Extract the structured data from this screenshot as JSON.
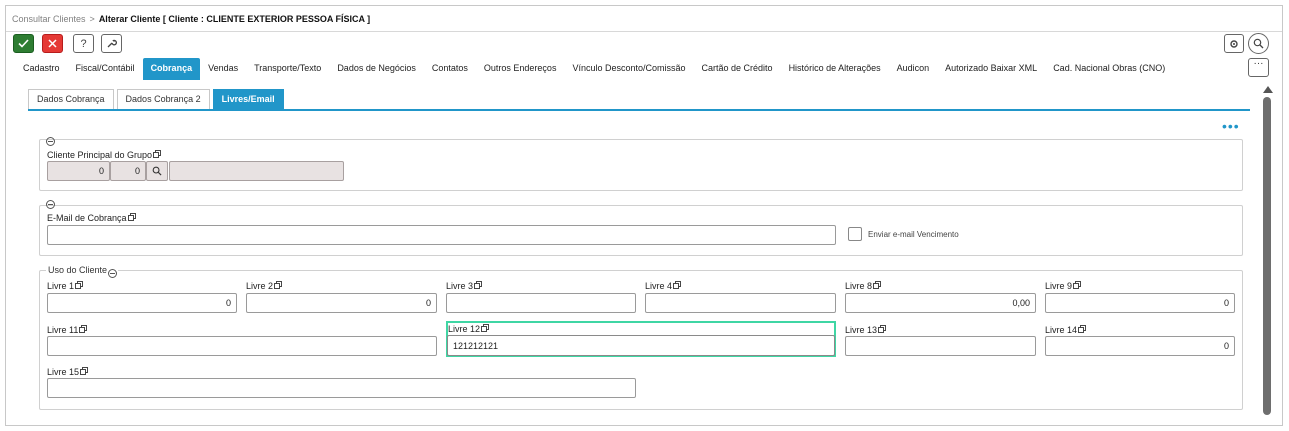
{
  "breadcrumb": {
    "link": "Consultar Clientes",
    "separator": ">",
    "current": "Alterar Cliente [ Cliente : CLIENTE EXTERIOR PESSOA FÍSICA ]"
  },
  "toolbar": {
    "confirm_icon": "check-icon",
    "cancel_icon": "x-icon",
    "help_label": "?",
    "tools_icon": "wrench-icon",
    "settings_icon": "gear-icon",
    "search_icon": "search-icon",
    "more_label": "···"
  },
  "main_tabs": [
    {
      "label": "Cadastro",
      "active": false
    },
    {
      "label": "Fiscal/Contábil",
      "active": false
    },
    {
      "label": "Cobrança",
      "active": true
    },
    {
      "label": "Vendas",
      "active": false
    },
    {
      "label": "Transporte/Texto",
      "active": false
    },
    {
      "label": "Dados de Negócios",
      "active": false
    },
    {
      "label": "Contatos",
      "active": false
    },
    {
      "label": "Outros Endereços",
      "active": false
    },
    {
      "label": "Vínculo Desconto/Comissão",
      "active": false
    },
    {
      "label": "Cartão de Crédito",
      "active": false
    },
    {
      "label": "Histórico de Alterações",
      "active": false
    },
    {
      "label": "Audicon",
      "active": false
    },
    {
      "label": "Autorizado Baixar XML",
      "active": false
    },
    {
      "label": "Cad. Nacional Obras (CNO)",
      "active": false
    }
  ],
  "sub_tabs": [
    {
      "label": "Dados Cobrança",
      "active": false
    },
    {
      "label": "Dados Cobrança 2",
      "active": false
    },
    {
      "label": "Livres/Email",
      "active": true
    }
  ],
  "options_dots": "•••",
  "group_cliente": {
    "label": "Cliente Principal do Grupo",
    "value1": "0",
    "value2": "0",
    "value_desc": ""
  },
  "group_email": {
    "label": "E-Mail de Cobrança",
    "value": "",
    "checkbox_label": "Enviar e-mail Vencimento",
    "checked": false
  },
  "group_uso": {
    "legend": "Uso do Cliente",
    "fields": [
      {
        "label": "Livre 1",
        "value": "0"
      },
      {
        "label": "Livre 2",
        "value": "0"
      },
      {
        "label": "Livre 3",
        "value": ""
      },
      {
        "label": "Livre 4",
        "value": ""
      },
      {
        "label": "Livre 8",
        "value": "0,00"
      },
      {
        "label": "Livre 9",
        "value": "0"
      },
      {
        "label": "Livre 11",
        "value": ""
      },
      {
        "label": "Livre 12",
        "value": "121212121"
      },
      {
        "label": "Livre 13",
        "value": ""
      },
      {
        "label": "Livre 14",
        "value": "0"
      },
      {
        "label": "Livre 15",
        "value": ""
      }
    ]
  },
  "colors": {
    "accent": "#2196c9",
    "ok": "#2e7d32",
    "cancel": "#e53935",
    "focus": "#3fd6a4"
  }
}
